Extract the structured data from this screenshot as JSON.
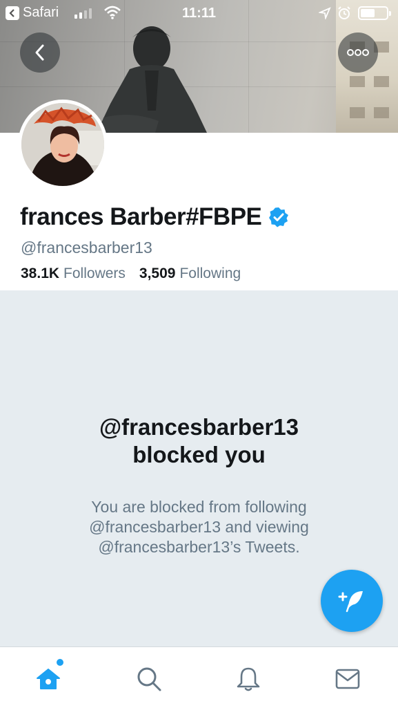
{
  "status_bar": {
    "back_app": "Safari",
    "time": "11:11"
  },
  "profile": {
    "display_name": "frances Barber#FBPE",
    "handle": "@francesbarber13",
    "followers_count": "38.1K",
    "followers_label": "Followers",
    "following_count": "3,509",
    "following_label": "Following",
    "verified": true
  },
  "blocked": {
    "title_line1": "@francesbarber13",
    "title_line2": "blocked you",
    "desc_line1": "You are blocked from following",
    "desc_line2": "@francesbarber13 and viewing",
    "desc_line3": "@francesbarber13’s Tweets."
  },
  "tabs": [
    {
      "icon": "home-icon",
      "active": true
    },
    {
      "icon": "search-icon",
      "active": false
    },
    {
      "icon": "bell-icon",
      "active": false
    },
    {
      "icon": "mail-icon",
      "active": false
    }
  ],
  "colors": {
    "accent": "#1da1f2",
    "text": "#14171a",
    "muted": "#657786",
    "background": "#e6ecf0"
  }
}
